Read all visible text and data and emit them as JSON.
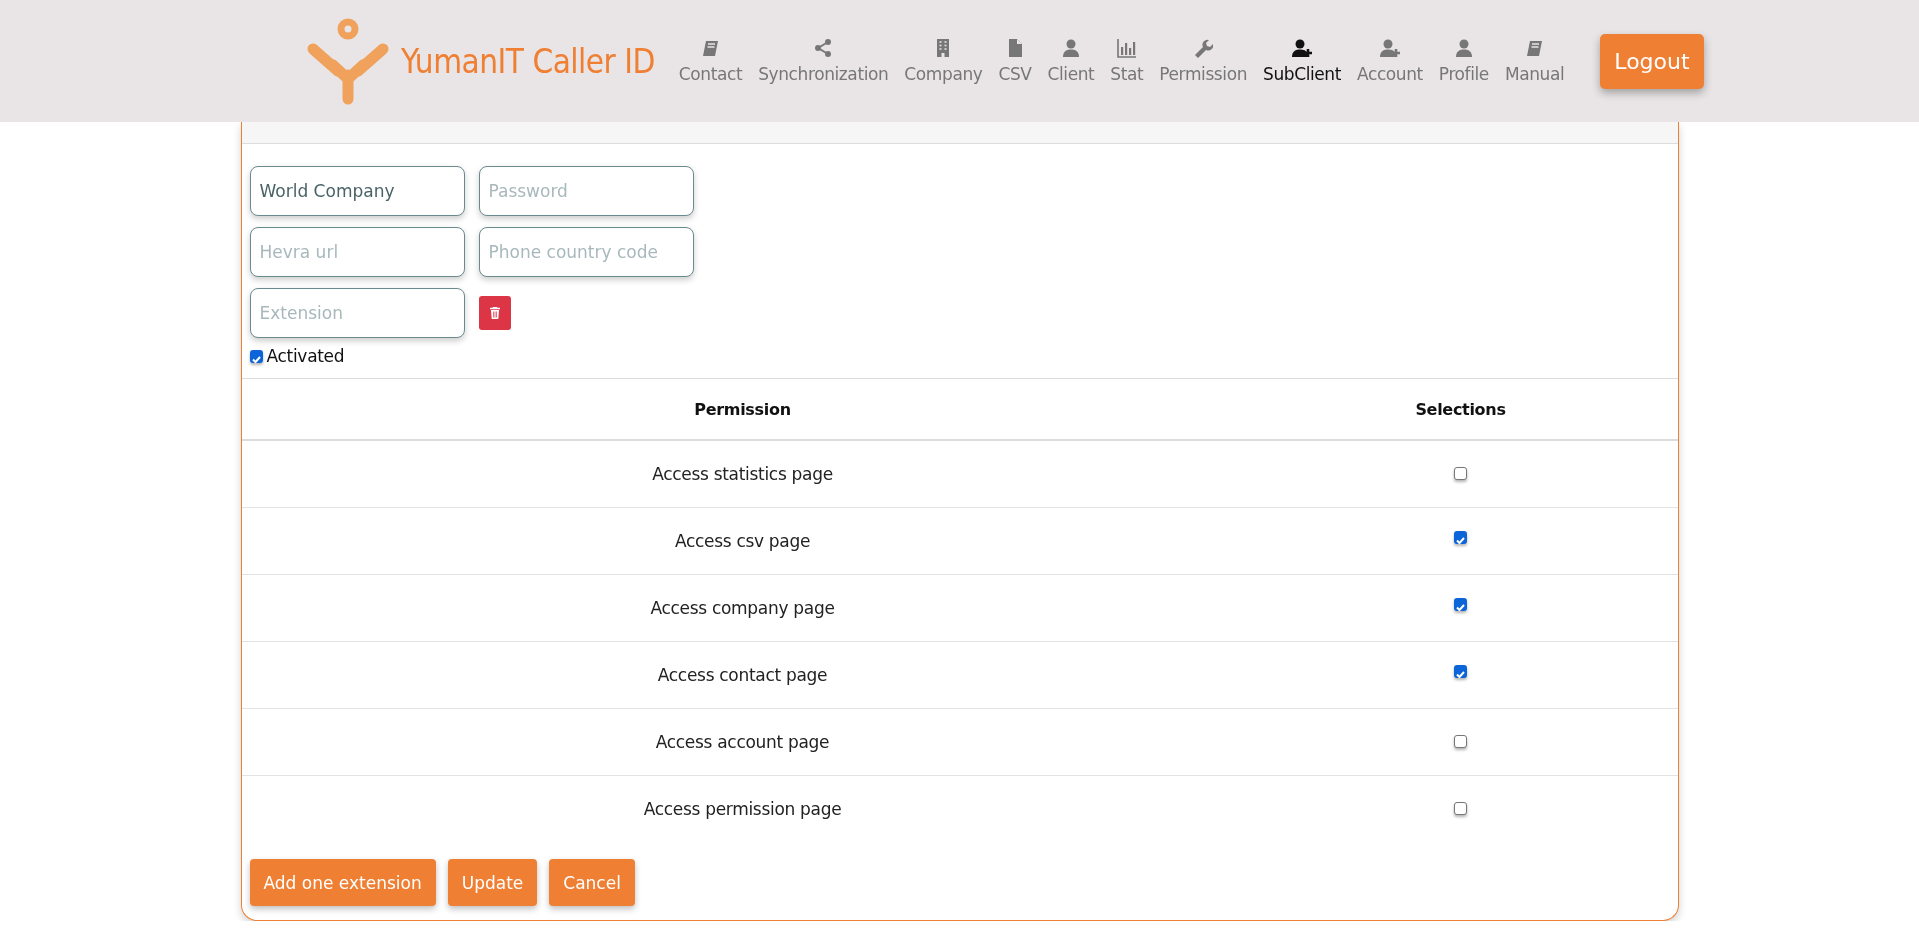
{
  "logo": {
    "text": "YumanIT Caller ID"
  },
  "nav": [
    {
      "label": "Contact",
      "kind": "book",
      "selected": false
    },
    {
      "label": "Synchronization",
      "kind": "share",
      "selected": false
    },
    {
      "label": "Company",
      "kind": "building",
      "selected": false
    },
    {
      "label": "CSV",
      "kind": "file",
      "selected": false
    },
    {
      "label": "Client",
      "kind": "user",
      "selected": false
    },
    {
      "label": "Stat",
      "kind": "chart",
      "selected": false
    },
    {
      "label": "Permission",
      "kind": "wrench",
      "selected": false
    },
    {
      "label": "SubClient",
      "kind": "adduser",
      "selected": true
    },
    {
      "label": "Account",
      "kind": "adduser",
      "selected": false
    },
    {
      "label": "Profile",
      "kind": "user",
      "selected": false
    },
    {
      "label": "Manual",
      "kind": "book",
      "selected": false
    }
  ],
  "logout": "Logout",
  "fields": [
    {
      "value": "World Company"
    },
    {
      "placeholder": "Password"
    },
    {
      "placeholder": "Hevra url"
    },
    {
      "placeholder": "Phone country code"
    }
  ],
  "extensions": [
    {
      "placeholder": "Extension"
    }
  ],
  "activated": {
    "label": "Activated",
    "checked": true
  },
  "permissions": {
    "columns": [
      "Permission",
      "Selections"
    ],
    "rows": [
      {
        "label": "Access statistics page",
        "checked": false
      },
      {
        "label": "Access csv page",
        "checked": true
      },
      {
        "label": "Access company page",
        "checked": true
      },
      {
        "label": "Access contact page",
        "checked": true
      },
      {
        "label": "Access account page",
        "checked": false
      },
      {
        "label": "Access permission page",
        "checked": false
      }
    ]
  },
  "buttons": [
    "Add one extension",
    "Update",
    "Cancel"
  ]
}
